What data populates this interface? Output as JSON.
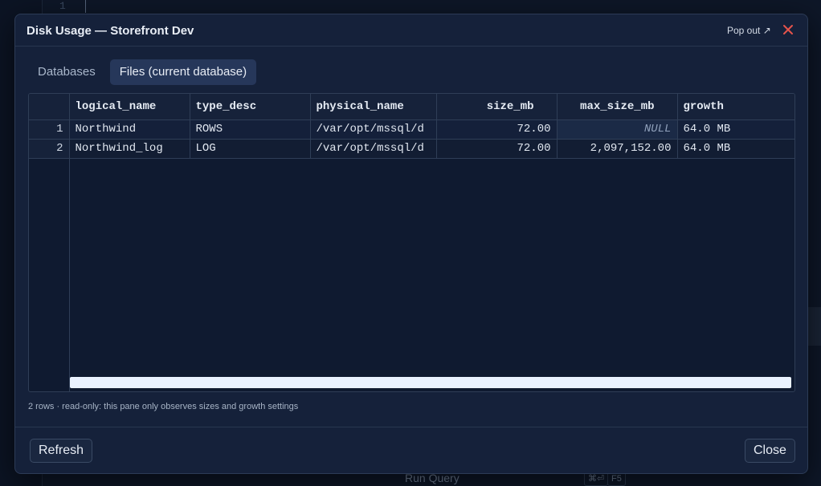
{
  "background": {
    "line_number": "1",
    "run_query_label": "Run Query",
    "shortcut_keys": [
      "⌘⏎",
      "F5"
    ]
  },
  "dialog": {
    "title": "Disk Usage — Storefront Dev",
    "popout_label": "Pop out ↗",
    "close_icon": "close-x-icon",
    "tabs": [
      {
        "label": "Databases",
        "active": false
      },
      {
        "label": "Files (current database)",
        "active": true
      }
    ],
    "grid": {
      "columns": [
        "",
        "logical_name",
        "type_desc",
        "physical_name",
        "size_mb",
        "max_size_mb",
        "growth"
      ],
      "rows": [
        [
          "1",
          "Northwind",
          "ROWS",
          "/var/opt/mssql/d",
          "72.00",
          "NULL",
          "64.0 MB"
        ],
        [
          "2",
          "Northwind_log",
          "LOG",
          "/var/opt/mssql/d",
          "72.00",
          "2,097,152.00",
          "64.0 MB"
        ]
      ]
    },
    "status_text": "2 rows · read-only: this pane only observes sizes and growth settings",
    "refresh_label": "Refresh",
    "close_label": "Close"
  },
  "colors": {
    "accent_close": "#e5534b",
    "active_tab": "#26375a",
    "dialog_bg": "#15213a"
  }
}
